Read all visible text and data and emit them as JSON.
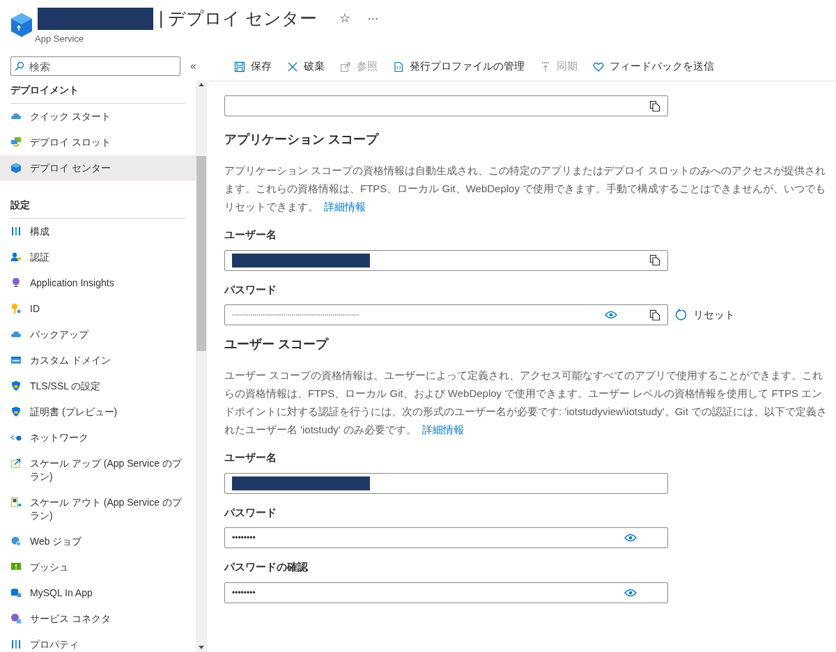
{
  "header": {
    "title": "| デプロイ センター",
    "subtitle": "App Service",
    "star": "☆",
    "more": "···"
  },
  "sidebar": {
    "search": {
      "placeholder": "検索"
    },
    "collapse": "«",
    "sections": [
      {
        "title": "デプロイメント",
        "items": [
          {
            "label": "クイック スタート",
            "selected": false
          },
          {
            "label": "デプロイ スロット",
            "selected": false
          },
          {
            "label": "デプロイ センター",
            "selected": true
          }
        ]
      },
      {
        "title": "設定",
        "items": [
          {
            "label": "構成",
            "selected": false
          },
          {
            "label": "認証",
            "selected": false
          },
          {
            "label": "Application Insights",
            "selected": false
          },
          {
            "label": "ID",
            "selected": false
          },
          {
            "label": "バックアップ",
            "selected": false
          },
          {
            "label": "カスタム ドメイン",
            "selected": false
          },
          {
            "label": "TLS/SSL の設定",
            "selected": false
          },
          {
            "label": "証明書 (プレビュー)",
            "selected": false
          },
          {
            "label": "ネットワーク",
            "selected": false
          },
          {
            "label": "スケール アップ (App Service のプラン)",
            "selected": false
          },
          {
            "label": "スケール アウト (App Service のプラン)",
            "selected": false
          },
          {
            "label": "Web ジョブ",
            "selected": false
          },
          {
            "label": "プッシュ",
            "selected": false
          },
          {
            "label": "MySQL In App",
            "selected": false
          },
          {
            "label": "サービス コネクタ",
            "selected": false
          },
          {
            "label": "プロパティ",
            "selected": false
          }
        ]
      }
    ]
  },
  "toolbar": [
    {
      "label": "保存",
      "disabled": false
    },
    {
      "label": "破棄",
      "disabled": false
    },
    {
      "label": "参照",
      "disabled": true
    },
    {
      "label": "発行プロファイルの管理",
      "disabled": false
    },
    {
      "label": "同期",
      "disabled": true
    },
    {
      "label": "フィードバックを送信",
      "disabled": false
    }
  ],
  "content": [
    {
      "kind": "copy-field"
    },
    {
      "kind": "heading",
      "text": "アプリケーション スコープ"
    },
    {
      "kind": "paragraph",
      "text": "アプリケーション スコープの資格情報は自動生成され、この特定のアプリまたはデプロイ スロットのみへのアクセスが提供されます。これらの資格情報は、FTPS、ローカル Git、WebDeploy で使用できます。手動で構成することはできませんが、いつでもリセットできます。",
      "link": "詳細情報"
    },
    {
      "kind": "label",
      "text": "ユーザー名"
    },
    {
      "kind": "redacted-copy-field"
    },
    {
      "kind": "label",
      "text": "パスワード"
    },
    {
      "kind": "generated-password-field",
      "value": "••••••••••••••••••••••••••••••••••••••••••••••••••••••••••••••",
      "reset": "リセット"
    },
    {
      "kind": "heading",
      "text": "ユーザー スコープ"
    },
    {
      "kind": "paragraph",
      "text": "ユーザー スコープの資格情報は、ユーザーによって定義され、アクセス可能なすべてのアプリで使用することができます。これらの資格情報は、FTPS、ローカル Git、および WebDeploy で使用できます。ユーザー レベルの資格情報を使用して FTPS エンドポイントに対する認証を行うには、次の形式のユーザー名が必要です: 'iotstudyview\\iotstudy'。Git での認証には、以下で定義されたユーザー名 'iotstudy' のみ必要です。",
      "link": "詳細情報"
    },
    {
      "kind": "label",
      "text": "ユーザー名"
    },
    {
      "kind": "redacted-field"
    },
    {
      "kind": "label",
      "text": "パスワード"
    },
    {
      "kind": "password-field",
      "value": "••••••••"
    },
    {
      "kind": "label",
      "text": "パスワードの確認"
    },
    {
      "kind": "password-field",
      "value": "••••••••"
    }
  ]
}
